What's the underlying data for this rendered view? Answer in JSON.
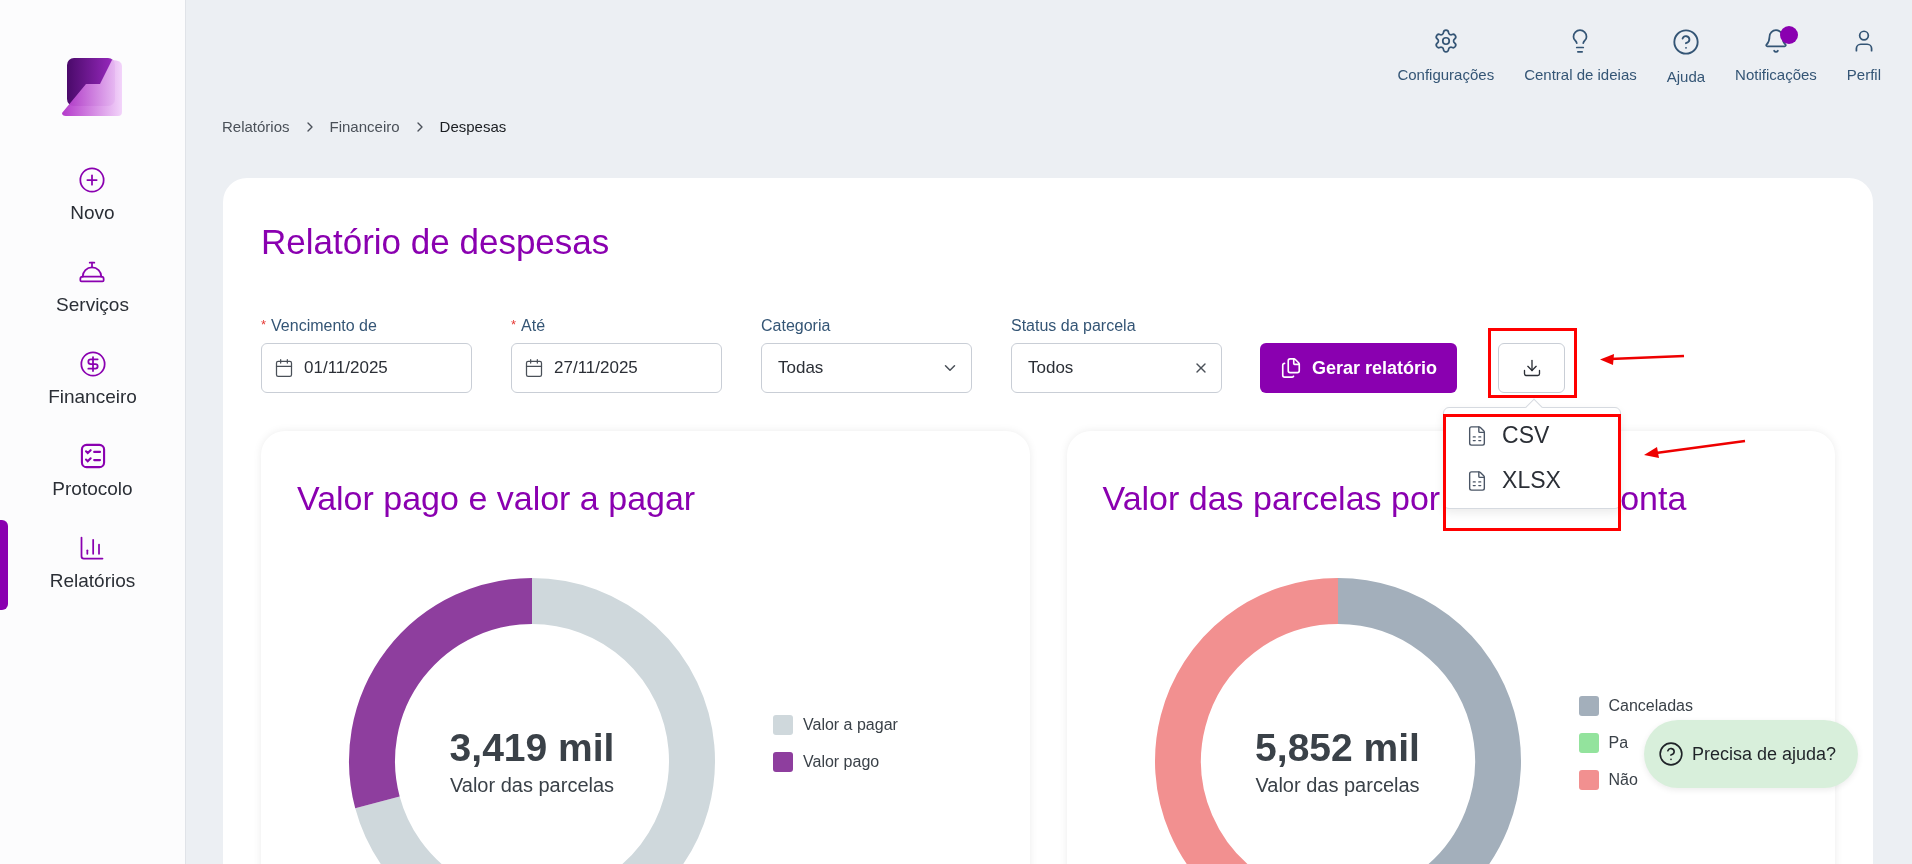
{
  "sidebar": {
    "items": [
      {
        "label": "Novo",
        "selected": false
      },
      {
        "label": "Serviços",
        "selected": false
      },
      {
        "label": "Financeiro",
        "selected": false
      },
      {
        "label": "Protocolo",
        "selected": false
      },
      {
        "label": "Relatórios",
        "selected": true
      }
    ]
  },
  "topbar": {
    "items": [
      {
        "label": "Configurações",
        "has_dot": false
      },
      {
        "label": "Central de ideias",
        "has_dot": false
      },
      {
        "label": "Ajuda",
        "has_dot": false
      },
      {
        "label": "Notificações",
        "has_dot": true
      },
      {
        "label": "Perfil",
        "has_dot": false
      }
    ]
  },
  "breadcrumb": [
    {
      "label": "Relatórios",
      "current": false
    },
    {
      "label": "Financeiro",
      "current": false
    },
    {
      "label": "Despesas",
      "current": true
    }
  ],
  "report": {
    "title": "Relatório de despesas",
    "filters": [
      {
        "label": "Vencimento de",
        "required_mark": "*",
        "kind": "date",
        "value": "01/11/2025"
      },
      {
        "label": "Até",
        "required_mark": "*",
        "kind": "date",
        "value": "27/11/2025"
      },
      {
        "label": "Categoria",
        "kind": "select",
        "value": "Todas"
      },
      {
        "label": "Status da parcela",
        "kind": "clearable",
        "value": "Todos"
      }
    ],
    "generate_button": "Gerar relatório",
    "export_menu": {
      "open": true,
      "items": [
        {
          "label": "CSV"
        },
        {
          "label": "XLSX"
        }
      ]
    }
  },
  "charts": [
    {
      "title_parts": [
        "Valor pago e valor a pagar"
      ],
      "total": "3,419 mil",
      "caption": "Valor das parcelas",
      "legend": [
        {
          "label": "Valor a pagar",
          "color": "#cfd8dc"
        },
        {
          "label": "Valor pago",
          "color": "#8e3e9e"
        }
      ]
    },
    {
      "title_parts": [
        "Valor das parcelas por",
        "onta"
      ],
      "total": "5,852 mil",
      "caption": "Valor das parcelas",
      "legend": [
        {
          "label": "Canceladas",
          "color": "#a3afbb"
        },
        {
          "label": "Pa",
          "color": "#93e39d"
        },
        {
          "label": "Não",
          "color": "#f29090"
        }
      ]
    }
  ],
  "help_button": "Precisa de ajuda?"
}
